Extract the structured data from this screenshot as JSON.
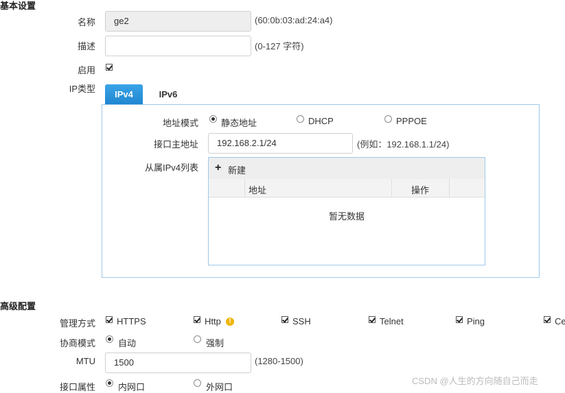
{
  "basic": {
    "section_title": "基本设置",
    "name_label": "名称",
    "name_value": "ge2",
    "name_hint": "(60:0b:03:ad:24:a4)",
    "desc_label": "描述",
    "desc_value": "",
    "desc_hint": "(0-127 字符)",
    "enable_label": "启用",
    "enable_checked": true,
    "iptype_label": "IP类型"
  },
  "tabs": [
    {
      "label": "IPv4",
      "active": true
    },
    {
      "label": "IPv6",
      "active": false
    }
  ],
  "ipv4": {
    "mode_label": "地址模式",
    "modes": [
      {
        "label": "静态地址",
        "checked": true
      },
      {
        "label": "DHCP",
        "checked": false
      },
      {
        "label": "PPPOE",
        "checked": false
      }
    ],
    "primary_label": "接口主地址",
    "primary_value": "192.168.2.1/24",
    "primary_hint": "(例如：192.168.1.1/24)",
    "secondary_label": "从属IPv4列表",
    "new_button": "新建",
    "columns": [
      "地址",
      "操作"
    ],
    "empty_text": "暂无数据"
  },
  "advanced": {
    "section_title": "高级配置",
    "mgmt_label": "管理方式",
    "mgmt_options": [
      {
        "label": "HTTPS",
        "checked": true
      },
      {
        "label": "Http",
        "checked": true
      },
      {
        "label": "SSH",
        "checked": true
      },
      {
        "label": "Telnet",
        "checked": true
      },
      {
        "label": "Ping",
        "checked": true
      },
      {
        "label": "Ce",
        "checked": true
      }
    ],
    "warn_symbol": "!",
    "negotiation_label": "协商模式",
    "negotiation_options": [
      {
        "label": "自动",
        "checked": true
      },
      {
        "label": "强制",
        "checked": false
      }
    ],
    "mtu_label": "MTU",
    "mtu_value": "1500",
    "mtu_hint": "(1280-1500)",
    "attr_label": "接口属性",
    "attr_options": [
      {
        "label": "内网口",
        "checked": true
      },
      {
        "label": "外网口",
        "checked": false
      }
    ]
  },
  "watermark": "CSDN @人生的方向随自己而走"
}
